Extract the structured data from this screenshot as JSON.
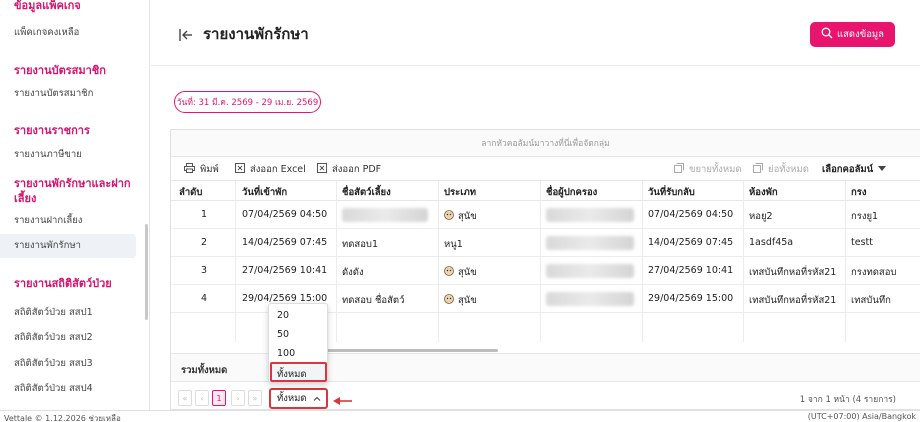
{
  "sidebar": {
    "sections": [
      {
        "heading": "ข้อมูลแพ็คเกจ",
        "items": [
          "แพ็คเกจคงเหลือ"
        ]
      },
      {
        "heading": "รายงานบัตรสมาชิก",
        "items": [
          "รายงานบัตรสมาชิก"
        ]
      },
      {
        "heading": "รายงานราชการ",
        "items": [
          "รายงานภาษีขาย"
        ]
      },
      {
        "heading": "รายงานพักรักษาและฝากเลี้ยง",
        "items": [
          "รายงานฝากเลี้ยง",
          "รายงานพักรักษา"
        ]
      },
      {
        "heading": "รายงานสถิติสัตว์ป่วย",
        "items": [
          "สถิติสัตว์ป่วย สสป1",
          "สถิติสัตว์ป่วย สสป2",
          "สถิติสัตว์ป่วย สสป3",
          "สถิติสัตว์ป่วย สสป4"
        ]
      }
    ],
    "active_item": "รายงานพักรักษา"
  },
  "header": {
    "title": "รายงานพักรักษา",
    "show_button": "แสดงข้อมูล"
  },
  "filter": {
    "date_range": "วันที่: 31 มี.ค. 2569 - 29 เม.ย. 2569"
  },
  "grid": {
    "group_hint": "ลากหัวคอลัมน์มาวางที่นี่เพื่อจัดกลุ่ม",
    "toolbar": {
      "print": "พิมพ์",
      "export_excel": "ส่งออก Excel",
      "export_pdf": "ส่งออก PDF",
      "expand_all": "ขยายทั้งหมด",
      "collapse_all": "ย่อทั้งหมด",
      "choose_columns": "เลือกคอลัมน์"
    },
    "columns": [
      "ลำดับ",
      "วันที่เข้าพัก",
      "ชื่อสัตว์เลี้ยง",
      "ประเภท",
      "ชื่อผู้ปกครอง",
      "วันที่รับกลับ",
      "ห้องพัก",
      "กรง"
    ],
    "rows": [
      {
        "no": "1",
        "checkin": "07/04/2569 04:50",
        "pet": "",
        "type": "สุนัข",
        "owner": "",
        "checkout": "07/04/2569 04:50",
        "room": "หอยู2",
        "cage": "กรงยู1"
      },
      {
        "no": "2",
        "checkin": "14/04/2569 07:45",
        "pet": "ทดสอบ1",
        "type": "หนู1",
        "owner": "",
        "checkout": "14/04/2569 07:45",
        "room": "1asdf45a",
        "cage": "testt"
      },
      {
        "no": "3",
        "checkin": "27/04/2569 10:41",
        "pet": "ดังดัง",
        "type": "สุนัข",
        "owner": "",
        "checkout": "27/04/2569 10:41",
        "room": "เทสบันทึกหอที่รหัส21",
        "cage": "กรงทดสอบ"
      },
      {
        "no": "4",
        "checkin": "29/04/2569 15:00",
        "pet": "ทดสอบ ชื่อสัตว์",
        "type": "สุนัข",
        "owner": "",
        "checkout": "29/04/2569 15:00",
        "room": "เทสบันทึกหอที่รหัส21",
        "cage": "เทสบันทึก"
      }
    ],
    "total_label": "รวมทั้งหมด",
    "pager": {
      "first": "«",
      "prev": "‹",
      "current": "1",
      "next": "›",
      "last": "»",
      "page_size": "ทั้งหมด",
      "info": "1 จาก 1 หน้า (4 รายการ)"
    },
    "page_size_options": [
      "20",
      "50",
      "100",
      "ทั้งหมด"
    ]
  },
  "statusbar": {
    "left": "Vettale © 1.12.2026  ช่วยเหลือ",
    "right": "(UTC+07:00) Asia/Bangkok"
  },
  "colors": {
    "accent": "#e8146e",
    "highlight": "#d9363e"
  }
}
